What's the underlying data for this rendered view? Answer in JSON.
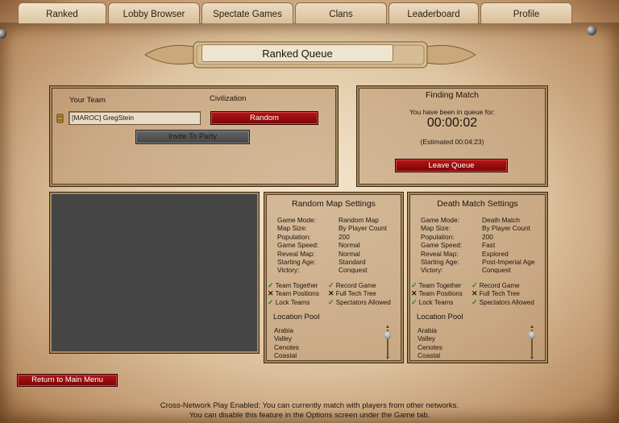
{
  "tabs": [
    {
      "label": "Ranked",
      "active": true
    },
    {
      "label": "Lobby Browser"
    },
    {
      "label": "Spectate Games"
    },
    {
      "label": "Clans"
    },
    {
      "label": "Leaderboard"
    },
    {
      "label": "Profile"
    }
  ],
  "page_title": "Ranked Queue",
  "team_panel": {
    "team_label": "Your Team",
    "civ_label": "Civilization",
    "player_name": "[MAROC] GregStein",
    "civ_value": "Random",
    "invite_button": "Invite To Party"
  },
  "match_panel": {
    "title": "Finding Match",
    "queue_text": "You have been in queue for:",
    "timer": "00:00:02",
    "estimated": "(Estimated 00:04:23)",
    "leave_button": "Leave Queue"
  },
  "random_map": {
    "title": "Random Map Settings",
    "keys": [
      "Game Mode:",
      "Map Size:",
      "Population:",
      "Game Speed:",
      "Reveal Map:",
      "Starting Age:",
      "Victory:"
    ],
    "values": [
      "Random Map",
      "By Player Count",
      "200",
      "Normal",
      "Normal",
      "Standard",
      "Conquest"
    ],
    "options_left": [
      {
        "mark": "✓",
        "label": "Team Together"
      },
      {
        "mark": "✕",
        "label": "Team Positions"
      },
      {
        "mark": "✓",
        "label": "Lock Teams"
      }
    ],
    "options_right": [
      {
        "mark": "✓",
        "label": "Record Game"
      },
      {
        "mark": "✕",
        "label": "Full Tech Tree"
      },
      {
        "mark": "✓",
        "label": "Spectators Allowed"
      }
    ],
    "pool_title": "Location Pool",
    "pool": [
      "Arabia",
      "Valley",
      "Cenotes",
      "Coastal"
    ]
  },
  "death_match": {
    "title": "Death Match Settings",
    "keys": [
      "Game Mode:",
      "Map Size:",
      "Population:",
      "Game Speed:",
      "Reveal Map:",
      "Starting Age:",
      "Victory:"
    ],
    "values": [
      "Death Match",
      "By Player Count",
      "200",
      "Fast",
      "Explored",
      "Post-Imperial Age",
      "Conquest"
    ],
    "options_left": [
      {
        "mark": "✓",
        "label": "Team Together"
      },
      {
        "mark": "✕",
        "label": "Team Positions"
      },
      {
        "mark": "✓",
        "label": "Lock Teams"
      }
    ],
    "options_right": [
      {
        "mark": "✓",
        "label": "Record Game"
      },
      {
        "mark": "✕",
        "label": "Full Tech Tree"
      },
      {
        "mark": "✓",
        "label": "Spectators Allowed"
      }
    ],
    "pool_title": "Location Pool",
    "pool": [
      "Arabia",
      "Valley",
      "Cenotes",
      "Coastal"
    ]
  },
  "return_button": "Return to Main Menu",
  "footer": {
    "line1": "Cross-Network Play Enabled: You can currently match with players from other networks.",
    "line2": "You can disable this feature in the Options screen under the Game tab."
  }
}
